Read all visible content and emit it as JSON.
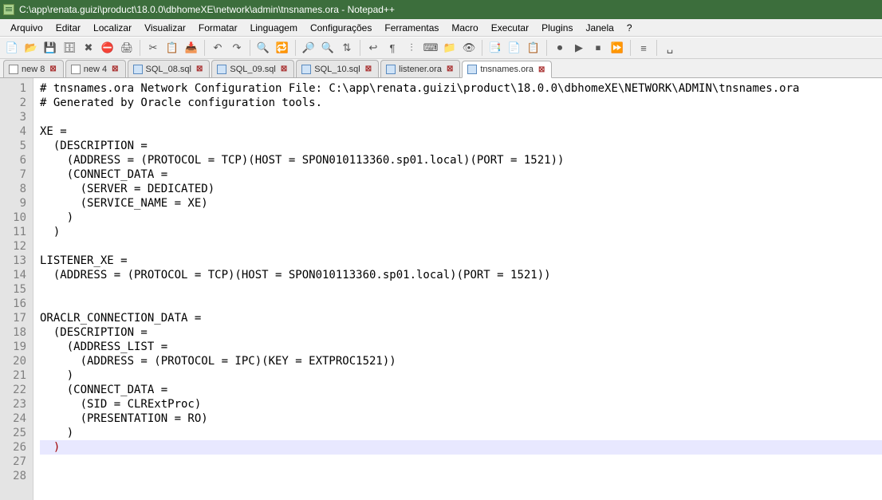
{
  "title": "C:\\app\\renata.guizi\\product\\18.0.0\\dbhomeXE\\network\\admin\\tnsnames.ora - Notepad++",
  "menus": {
    "arquivo": "Arquivo",
    "editar": "Editar",
    "localizar": "Localizar",
    "visualizar": "Visualizar",
    "formatar": "Formatar",
    "linguagem": "Linguagem",
    "configuracoes": "Configurações",
    "ferramentas": "Ferramentas",
    "macro": "Macro",
    "executar": "Executar",
    "plugins": "Plugins",
    "janela": "Janela",
    "help": "?"
  },
  "tabs": [
    {
      "label": "new 8",
      "active": false,
      "blue": false
    },
    {
      "label": "new 4",
      "active": false,
      "blue": false
    },
    {
      "label": "SQL_08.sql",
      "active": false,
      "blue": true
    },
    {
      "label": "SQL_09.sql",
      "active": false,
      "blue": true
    },
    {
      "label": "SQL_10.sql",
      "active": false,
      "blue": true
    },
    {
      "label": "listener.ora",
      "active": false,
      "blue": true
    },
    {
      "label": "tnsnames.ora",
      "active": true,
      "blue": true
    }
  ],
  "code": {
    "lines": [
      "# tnsnames.ora Network Configuration File: C:\\app\\renata.guizi\\product\\18.0.0\\dbhomeXE\\NETWORK\\ADMIN\\tnsnames.ora",
      "# Generated by Oracle configuration tools.",
      "",
      "XE =",
      "  (DESCRIPTION =",
      "    (ADDRESS = (PROTOCOL = TCP)(HOST = SPON010113360.sp01.local)(PORT = 1521))",
      "    (CONNECT_DATA =",
      "      (SERVER = DEDICATED)",
      "      (SERVICE_NAME = XE)",
      "    )",
      "  )",
      "",
      "LISTENER_XE =",
      "  (ADDRESS = (PROTOCOL = TCP)(HOST = SPON010113360.sp01.local)(PORT = 1521))",
      "",
      "",
      "ORACLR_CONNECTION_DATA =",
      "  (DESCRIPTION =",
      "    (ADDRESS_LIST =",
      "      (ADDRESS = (PROTOCOL = IPC)(KEY = EXTPROC1521))",
      "    )",
      "    (CONNECT_DATA =",
      "      (SID = CLRExtProc)",
      "      (PRESENTATION = RO)",
      "    )",
      "  )",
      "",
      ""
    ],
    "highlight_line": 26
  },
  "toolbar_icons": [
    "new-file",
    "open-file",
    "save-file",
    "save-all",
    "close-file",
    "close-all",
    "print",
    "sep",
    "cut",
    "copy",
    "paste",
    "sep",
    "undo",
    "redo",
    "sep",
    "find",
    "replace",
    "sep",
    "zoom-in",
    "zoom-out",
    "sync-v",
    "sep",
    "word-wrap",
    "show-all-chars",
    "indent-guide",
    "lang",
    "folder",
    "monitor",
    "sep",
    "toggle-1",
    "toggle-2",
    "toggle-3",
    "sep",
    "record-macro",
    "play-macro",
    "stop-macro",
    "playback",
    "sep",
    "hide-lines",
    "sep",
    "spaces"
  ]
}
